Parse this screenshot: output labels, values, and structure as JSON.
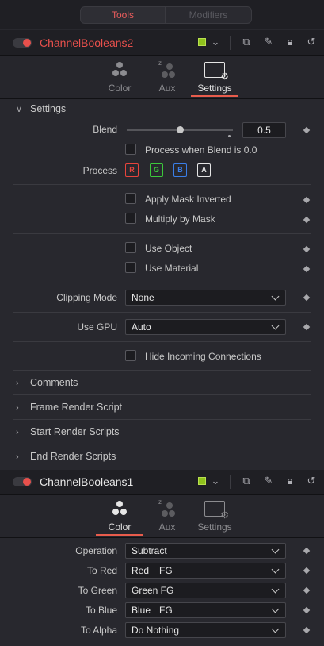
{
  "top_tabs": {
    "tools": "Tools",
    "modifiers": "Modifiers"
  },
  "node1": {
    "name": "ChannelBooleans2",
    "name_color": "#e8504c",
    "swatch_color": "#8fc21c",
    "subtabs": [
      "Color",
      "Aux",
      "Settings"
    ],
    "active_subtab": "Settings",
    "settings_header": "Settings",
    "blend_label": "Blend",
    "blend_value": "0.5",
    "blend_fraction": 0.5,
    "process_when_blend": "Process when Blend is 0.0",
    "process_label": "Process",
    "channels": [
      "R",
      "G",
      "B",
      "A"
    ],
    "apply_mask_inverted": "Apply Mask Inverted",
    "multiply_by_mask": "Multiply by Mask",
    "use_object": "Use Object",
    "use_material": "Use Material",
    "clipping_mode_label": "Clipping Mode",
    "clipping_mode_value": "None",
    "use_gpu_label": "Use GPU",
    "use_gpu_value": "Auto",
    "hide_incoming": "Hide Incoming Connections",
    "sections": [
      "Comments",
      "Frame Render Script",
      "Start Render Scripts",
      "End Render Scripts"
    ]
  },
  "node2": {
    "name": "ChannelBooleans1",
    "name_color": "#e6e6e6",
    "swatch_color": "#8fc21c",
    "subtabs": [
      "Color",
      "Aux",
      "Settings"
    ],
    "active_subtab": "Color",
    "rows": [
      {
        "label": "Operation",
        "value": "Subtract",
        "suffix": ""
      },
      {
        "label": "To Red",
        "value": "Red",
        "suffix": "FG"
      },
      {
        "label": "To Green",
        "value": "Green FG",
        "suffix": ""
      },
      {
        "label": "To Blue",
        "value": "Blue",
        "suffix": "FG"
      },
      {
        "label": "To Alpha",
        "value": "Do Nothing",
        "suffix": ""
      }
    ]
  },
  "colors": {
    "accent": "#e85c4c",
    "chan_r": "#e8443c",
    "chan_g": "#3cc83c",
    "chan_b": "#3a7ee8",
    "chan_a": "#e6e6e6"
  },
  "icons": [
    "toggle-icon",
    "chevron-down-icon",
    "versions-icon",
    "pin-icon",
    "lock-icon",
    "reset-icon",
    "diamond-keyframe-icon"
  ]
}
